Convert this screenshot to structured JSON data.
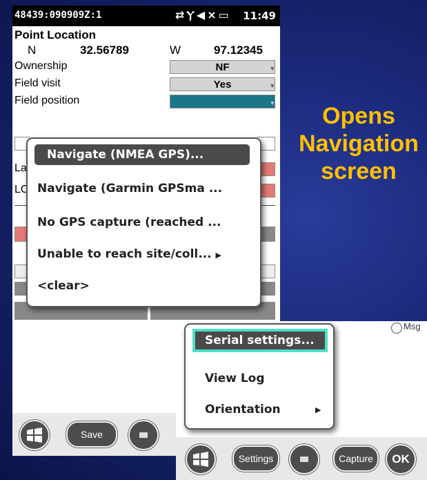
{
  "top_screen": {
    "status": {
      "device": "48439:090909Z:1",
      "time": "11:49"
    },
    "section_title": "Point Location",
    "coords": {
      "lat_hem": "N",
      "lat": "32.56789",
      "lon_hem": "W",
      "lon": "97.12345"
    },
    "fields": [
      {
        "label": "Ownership",
        "value": "NF"
      },
      {
        "label": "Field visit",
        "value": "Yes"
      },
      {
        "label": "Field position",
        "value": ""
      }
    ],
    "hidden_labels": {
      "a": "La",
      "b": "LC"
    },
    "context_menu": [
      "Navigate (NMEA GPS)...",
      "Navigate (Garmin GPSma ...",
      "No GPS capture (reached ...",
      "Unable to reach site/coll... ",
      "<clear>"
    ],
    "bottom_bar": {
      "save_label": "Save"
    }
  },
  "bottom_screen": {
    "radio_label": "Msg",
    "menu": [
      "Serial settings...",
      "View Log",
      "Orientation"
    ],
    "bottom_bar": {
      "settings_label": "Settings",
      "capture_label": "Capture",
      "ok_label": "OK"
    }
  },
  "callout": {
    "line1": "Opens",
    "line2": "Navigation",
    "line3": "screen"
  },
  "colors": {
    "callout": "#ffc000",
    "highlight": "#4fe0c9",
    "teal_field": "#197789",
    "red_field": "#e67a76",
    "background": "#1a2878"
  }
}
